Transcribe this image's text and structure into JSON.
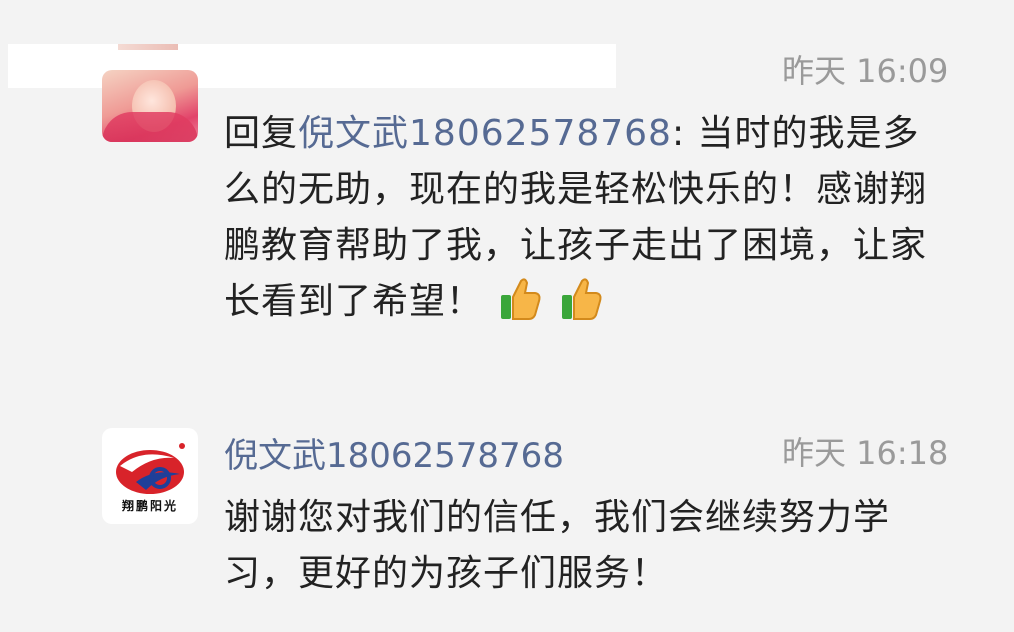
{
  "comments": [
    {
      "author": "",
      "time": "昨天 16:09",
      "reply_prefix": "回复",
      "mention": "倪文武18062578768",
      "text": ": 当时的我是多么的无助，现在的我是轻松快乐的！感谢翔鹏教育帮助了我，让孩子走出了困境，让家长看到了希望！",
      "emoji": [
        "thumbs-up-icon",
        "thumbs-up-icon"
      ]
    },
    {
      "author": "倪文武18062578768",
      "time": "昨天 16:18",
      "text": "谢谢您对我们的信任，我们会继续努力学习，更好的为孩子们服务！",
      "avatar_logo_text": "翔鹏阳光"
    }
  ],
  "colors": {
    "background": "#f3f3f3",
    "name": "#566a93",
    "time": "#9a9a9a",
    "text": "#222222"
  }
}
